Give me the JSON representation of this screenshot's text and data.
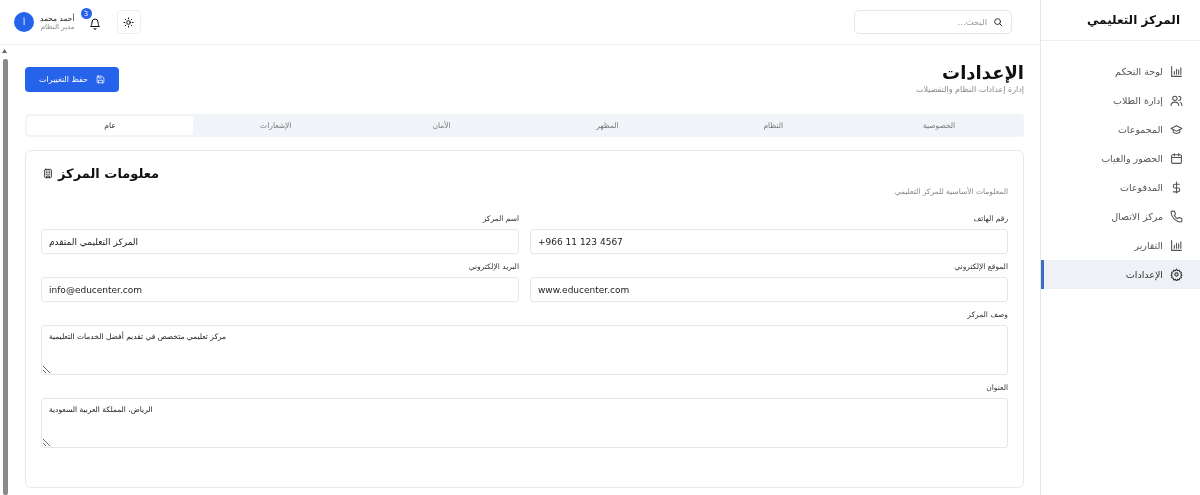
{
  "sidebar": {
    "title": "المركز التعليمي",
    "items": [
      {
        "label": "لوحة التحكم",
        "kind": "chart",
        "selected": false
      },
      {
        "label": "إدارة الطلاب",
        "kind": "users",
        "selected": false
      },
      {
        "label": "المجموعات",
        "kind": "cap",
        "selected": false
      },
      {
        "label": "الحضور والغياب",
        "kind": "calendar",
        "selected": false
      },
      {
        "label": "المدفوعات",
        "kind": "dollar",
        "selected": false
      },
      {
        "label": "مركز الاتصال",
        "kind": "phone",
        "selected": false
      },
      {
        "label": "التقارير",
        "kind": "chart",
        "selected": false
      },
      {
        "label": "الإعدادات",
        "kind": "gear",
        "selected": true
      }
    ]
  },
  "header": {
    "search": {
      "placeholder": "البحث..."
    },
    "notifications": "3",
    "user": {
      "name": "أحمد محمد",
      "role": "مدير النظام",
      "initial": "أ"
    }
  },
  "page": {
    "title": "الإعدادات",
    "subtitle": "إدارة إعدادات النظام والتفضيلات",
    "save_button": "حفظ التغييرات"
  },
  "tabs": [
    {
      "label": "الخصوصية",
      "selected": false
    },
    {
      "label": "النظام",
      "selected": false
    },
    {
      "label": "المظهر",
      "selected": false
    },
    {
      "label": "الأمان",
      "selected": false
    },
    {
      "label": "الإشعارات",
      "selected": false
    },
    {
      "label": "عام",
      "selected": true
    }
  ],
  "card": {
    "title": "معلومات المركز",
    "subtitle": "المعلومات الأساسية للمركز التعليمي",
    "fields": [
      {
        "label": "رقم الهاتف",
        "value": "+966 11 123 4567",
        "kind": "input"
      },
      {
        "label": "اسم المركز",
        "value": "المركز التعليمي المتقدم",
        "kind": "input"
      },
      {
        "label": "الموقع الإلكتروني",
        "value": "www.educenter.com",
        "kind": "input"
      },
      {
        "label": "البريد الإلكتروني",
        "value": "info@educenter.com",
        "kind": "input"
      },
      {
        "label": "وصف المركز",
        "value": "مركز تعليمي متخصص في تقديم أفضل الخدمات التعليمية",
        "kind": "textarea"
      },
      {
        "label": "العنوان",
        "value": "الرياض، المملكة العربية السعودية",
        "kind": "textarea"
      }
    ]
  }
}
